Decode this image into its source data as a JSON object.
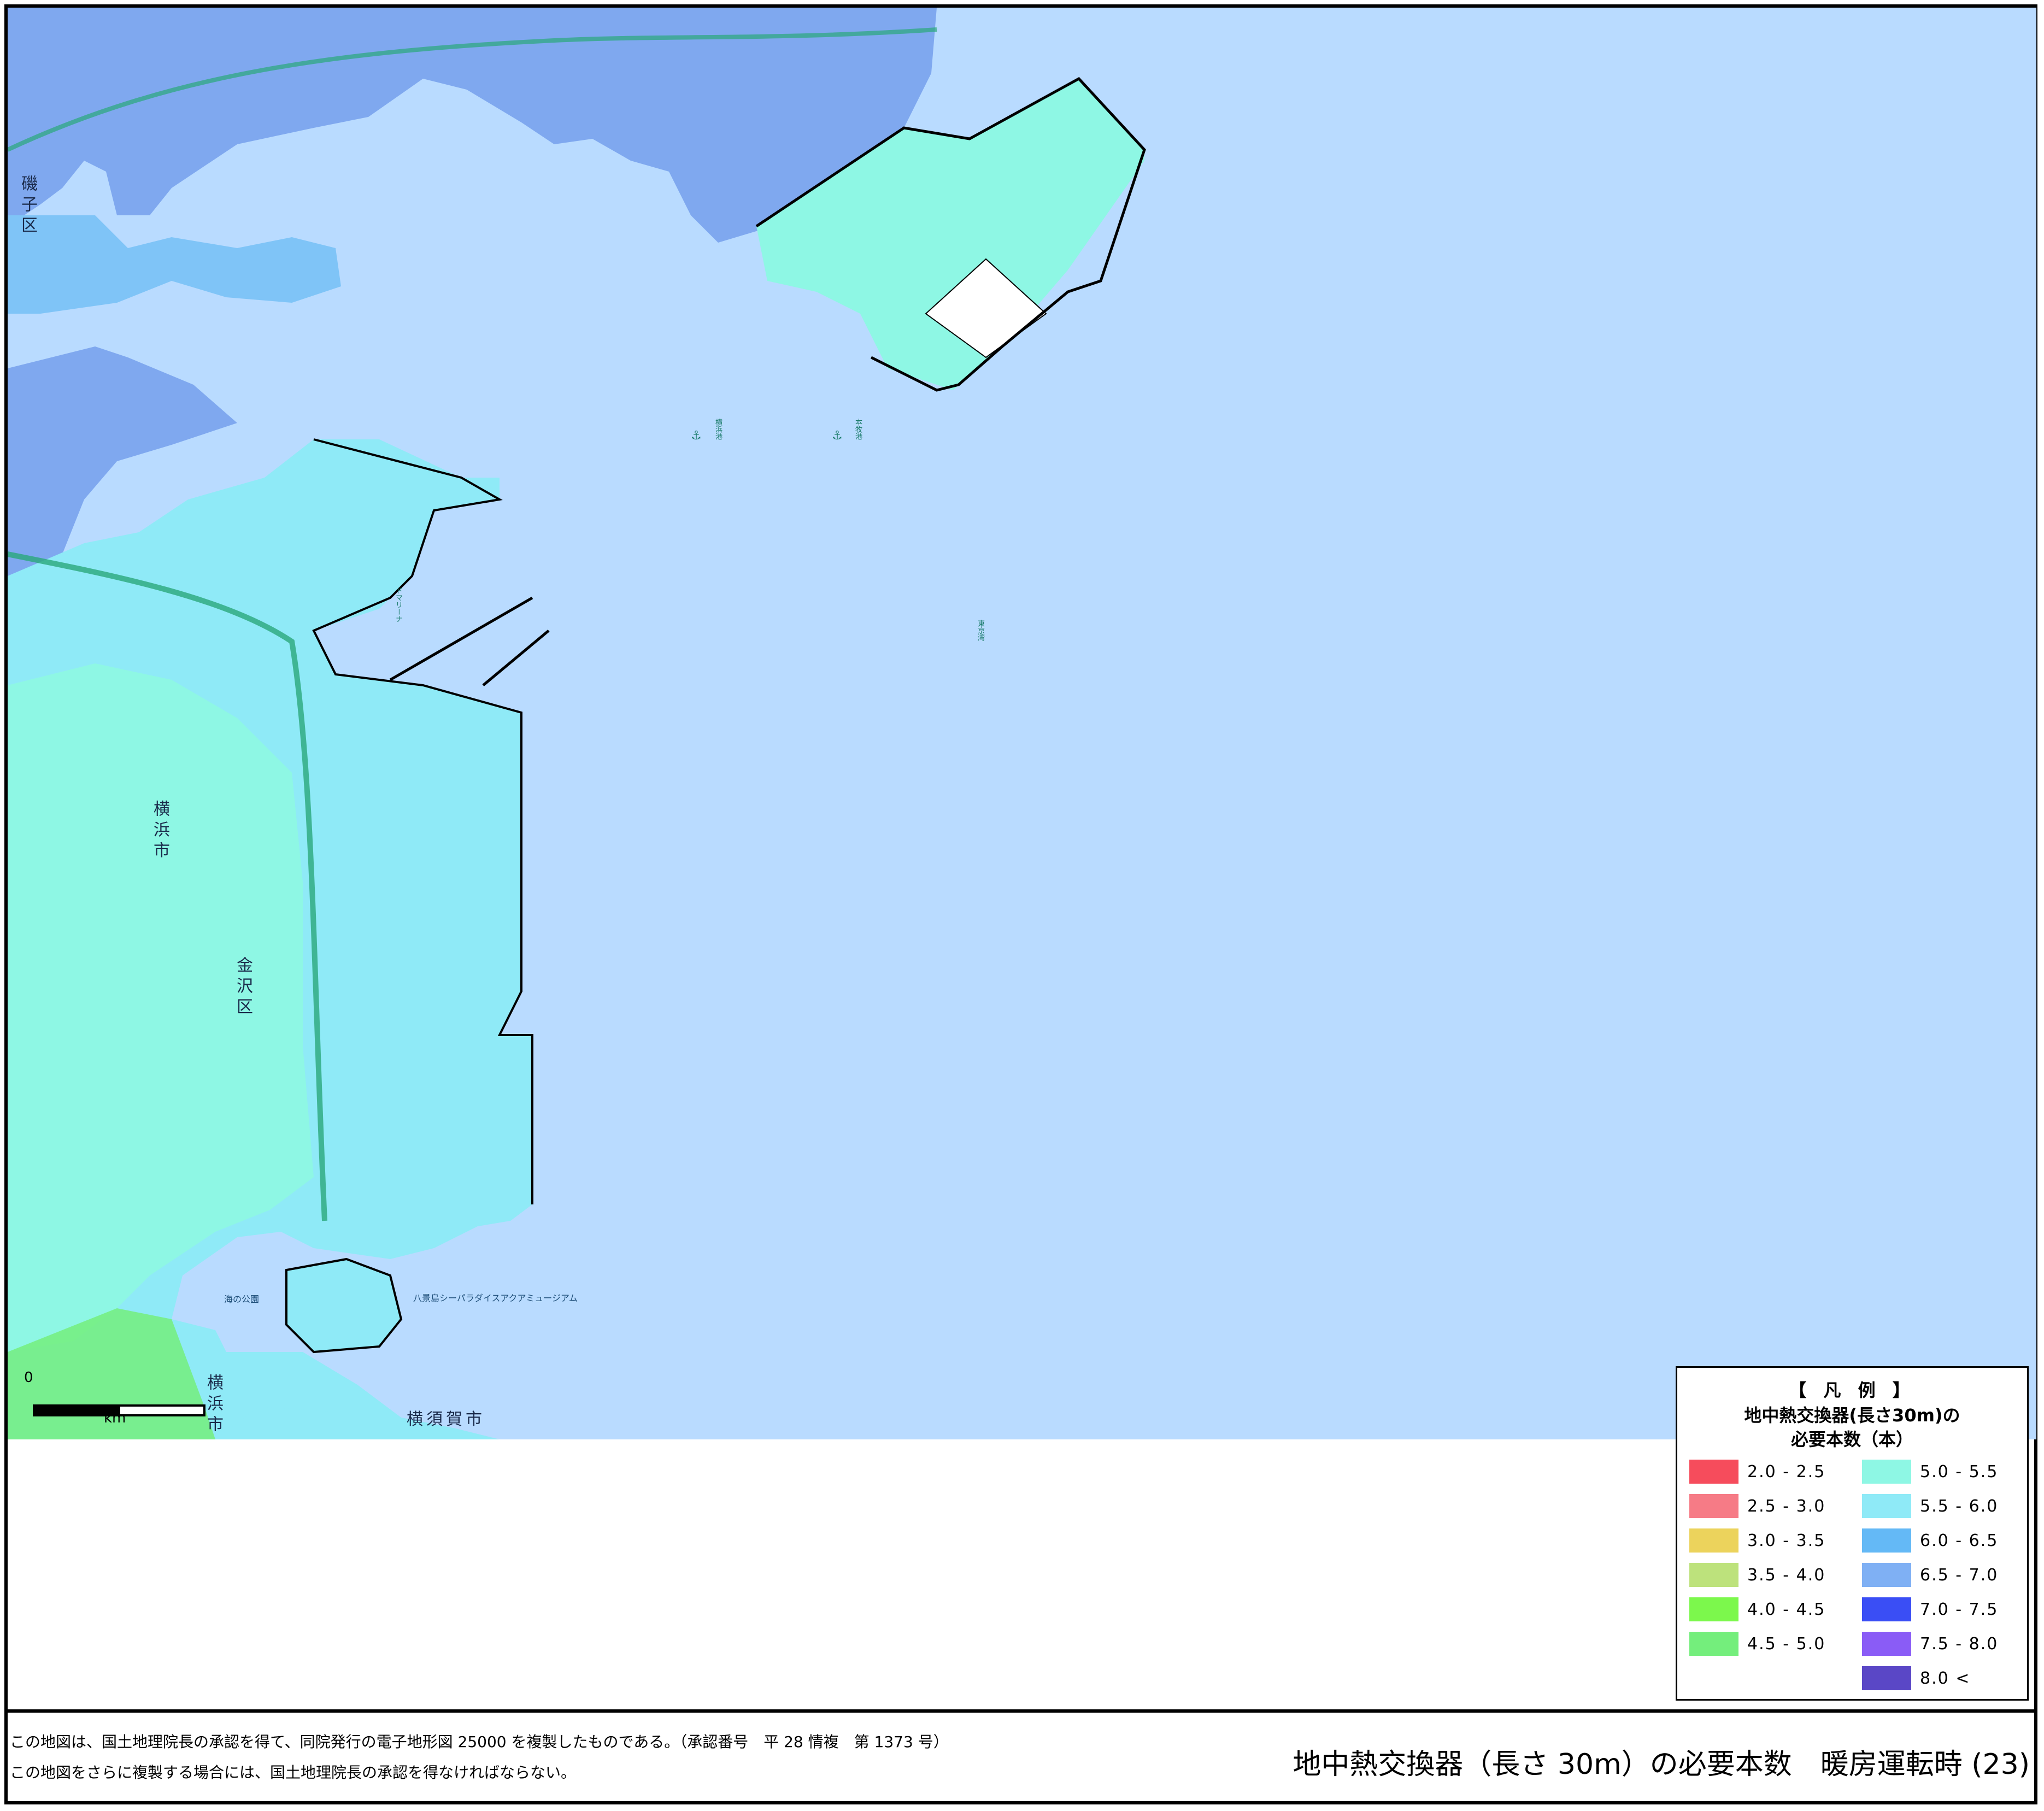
{
  "map": {
    "place_labels": {
      "isogo_ku": "磯子区",
      "yokohama_shi": "横浜市",
      "kanazawa_ku": "金沢区",
      "yokosuka_shi": "横須賀市",
      "yokohama_shi_lower": "横浜市",
      "marina": "ドマリーナ",
      "sea_paradise": "八景島シーパラダイスアクアミュージアム",
      "umi_no_koen": "海の公園",
      "sea_name": "東京湾",
      "anchorage_1": "横浜港",
      "anchorage_2": "本牧港"
    },
    "colors": {
      "sea": "#b9dbff",
      "band_5_0_5_5": "#8ef7e4",
      "band_5_5_6_0": "#8feaf7",
      "band_6_0_6_5": "#7fc4f7",
      "band_6_5_7_0": "#7fa8ef",
      "band_4_5_5_0": "#74ee7c",
      "unrated": "#ffffff"
    },
    "scale": {
      "zero_label": "0",
      "unit_label": "km"
    }
  },
  "legend": {
    "title": "【 凡 例 】",
    "subtitle_line1": "地中熱交換器(長さ30m)の",
    "subtitle_line2": "必要本数（本）",
    "items": [
      {
        "label": "2.0 - 2.5",
        "color": "#f64c5c"
      },
      {
        "label": "2.5 - 3.0",
        "color": "#f67b86"
      },
      {
        "label": "3.0 - 3.5",
        "color": "#ecd35c"
      },
      {
        "label": "3.5 - 4.0",
        "color": "#bde27c"
      },
      {
        "label": "4.0 - 4.5",
        "color": "#7cf84c"
      },
      {
        "label": "4.5 - 5.0",
        "color": "#74ee7c"
      },
      {
        "label": "5.0 - 5.5",
        "color": "#8ef7e4"
      },
      {
        "label": "5.5 - 6.0",
        "color": "#8feaf7"
      },
      {
        "label": "6.0 - 6.5",
        "color": "#64b9f6"
      },
      {
        "label": "6.5 - 7.0",
        "color": "#7fb0f4"
      },
      {
        "label": "7.0 - 7.5",
        "color": "#3a4ef5"
      },
      {
        "label": "7.5 - 8.0",
        "color": "#8a5cf6"
      },
      {
        "label": "8.0 <",
        "color": "#5a47c6"
      }
    ]
  },
  "footer": {
    "note1": "この地図は、国土地理院長の承認を得て、同院発行の電子地形図 25000 を複製したものである。（承認番号　平 28 情複　第 1373 号）",
    "note2": "この地図をさらに複製する場合には、国土地理院長の承認を得なければならない。",
    "title": "地中熱交換器（長さ 30m）の必要本数　暖房運転時 (23)"
  }
}
